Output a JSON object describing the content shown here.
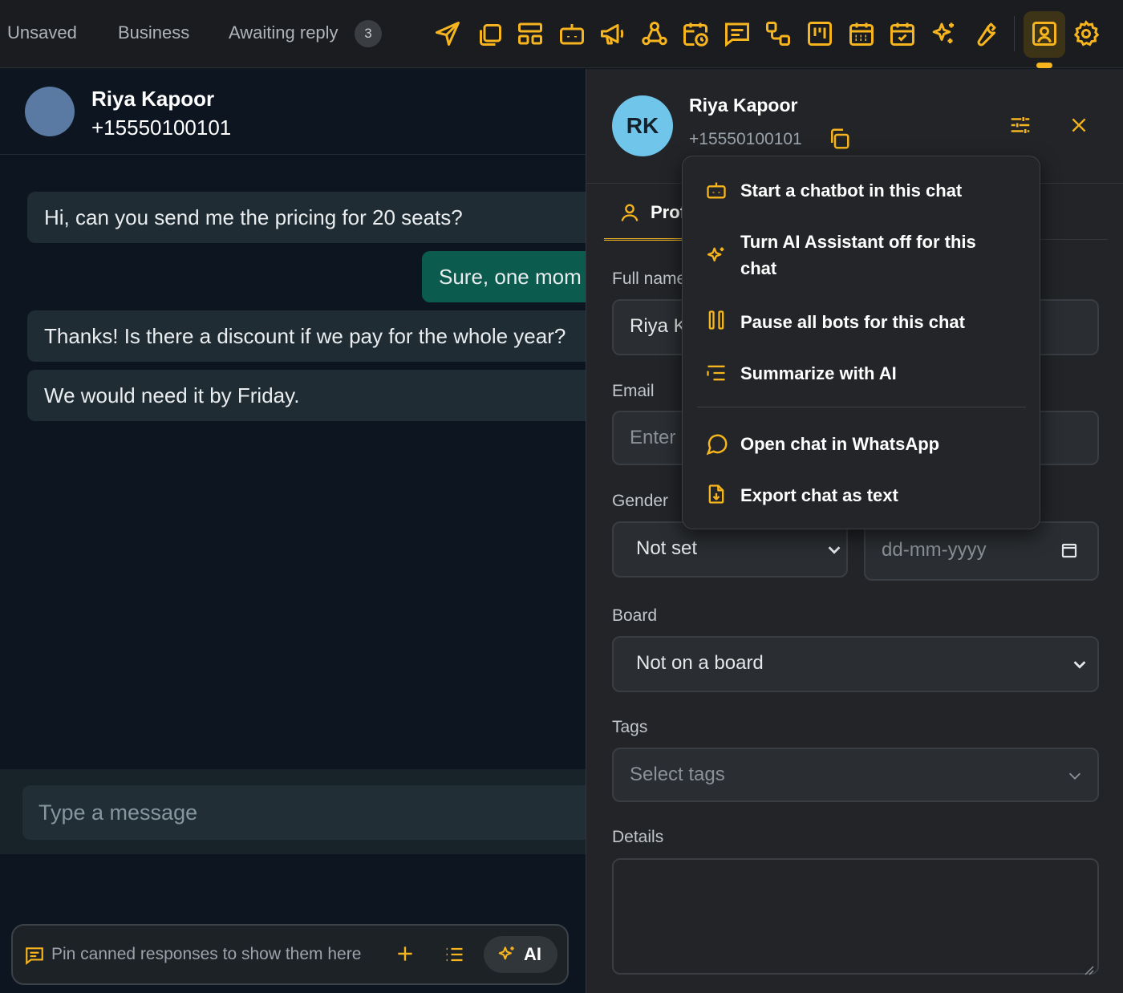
{
  "topbar": {
    "filters": [
      "Unsaved",
      "Business",
      "Awaiting reply"
    ],
    "awaiting_count": "3",
    "icons": [
      "send-icon",
      "copy-icon",
      "layout-icon",
      "bot-icon",
      "megaphone-icon",
      "webhook-icon",
      "calendar-clock-icon",
      "message-square-icon",
      "workflow-icon",
      "kanban-icon",
      "calendar-grid-icon",
      "calendar-check-icon",
      "sparkles-icon",
      "wrench-icon",
      "contact-card-icon",
      "gear-icon"
    ],
    "active_icon": "contact-card-icon",
    "accent_color": "#f6b41e"
  },
  "chat": {
    "contact_name": "Riya Kapoor",
    "contact_phone": "+15550100101",
    "messages": [
      {
        "direction": "in",
        "text": "Hi, can you send me the pricing for 20 seats?"
      },
      {
        "direction": "out",
        "text": "Sure, one mom"
      },
      {
        "direction": "in",
        "text": "Thanks! Is there a discount if we pay for the whole year?"
      },
      {
        "direction": "in",
        "text": "We would need it by Friday."
      }
    ],
    "composer_placeholder": "Type a message",
    "canned_hint": "Pin canned responses to show them here",
    "ai_button_label": "AI",
    "outgoing_bubble_color": "#0b5c4e",
    "incoming_bubble_color": "#1f2c33"
  },
  "panel": {
    "initials": "RK",
    "name": "Riya Kapoor",
    "phone": "+15550100101",
    "tab_label": "Prof",
    "full_name_label": "Full name",
    "full_name_value": "Riya K",
    "email_label": "Email",
    "email_placeholder": "Enter e",
    "gender_label": "Gender",
    "gender_value": "Not set",
    "birthday_placeholder": "dd-mm-yyyy",
    "board_label": "Board",
    "board_value": "Not on a board",
    "tags_label": "Tags",
    "tags_placeholder": "Select tags",
    "details_label": "Details",
    "avatar_color": "#6fc6ea"
  },
  "menu": {
    "items": [
      {
        "icon": "bot-icon",
        "label": "Start a chatbot in this chat"
      },
      {
        "icon": "sparkles-icon",
        "label": "Turn AI Assistant off for this chat"
      },
      {
        "icon": "pause-icon",
        "label": "Pause all bots for this chat"
      },
      {
        "icon": "list-indent-icon",
        "label": "Summarize with AI"
      },
      {
        "icon": "message-circle-icon",
        "label": "Open chat in WhatsApp"
      },
      {
        "icon": "file-download-icon",
        "label": "Export chat as text"
      }
    ]
  }
}
